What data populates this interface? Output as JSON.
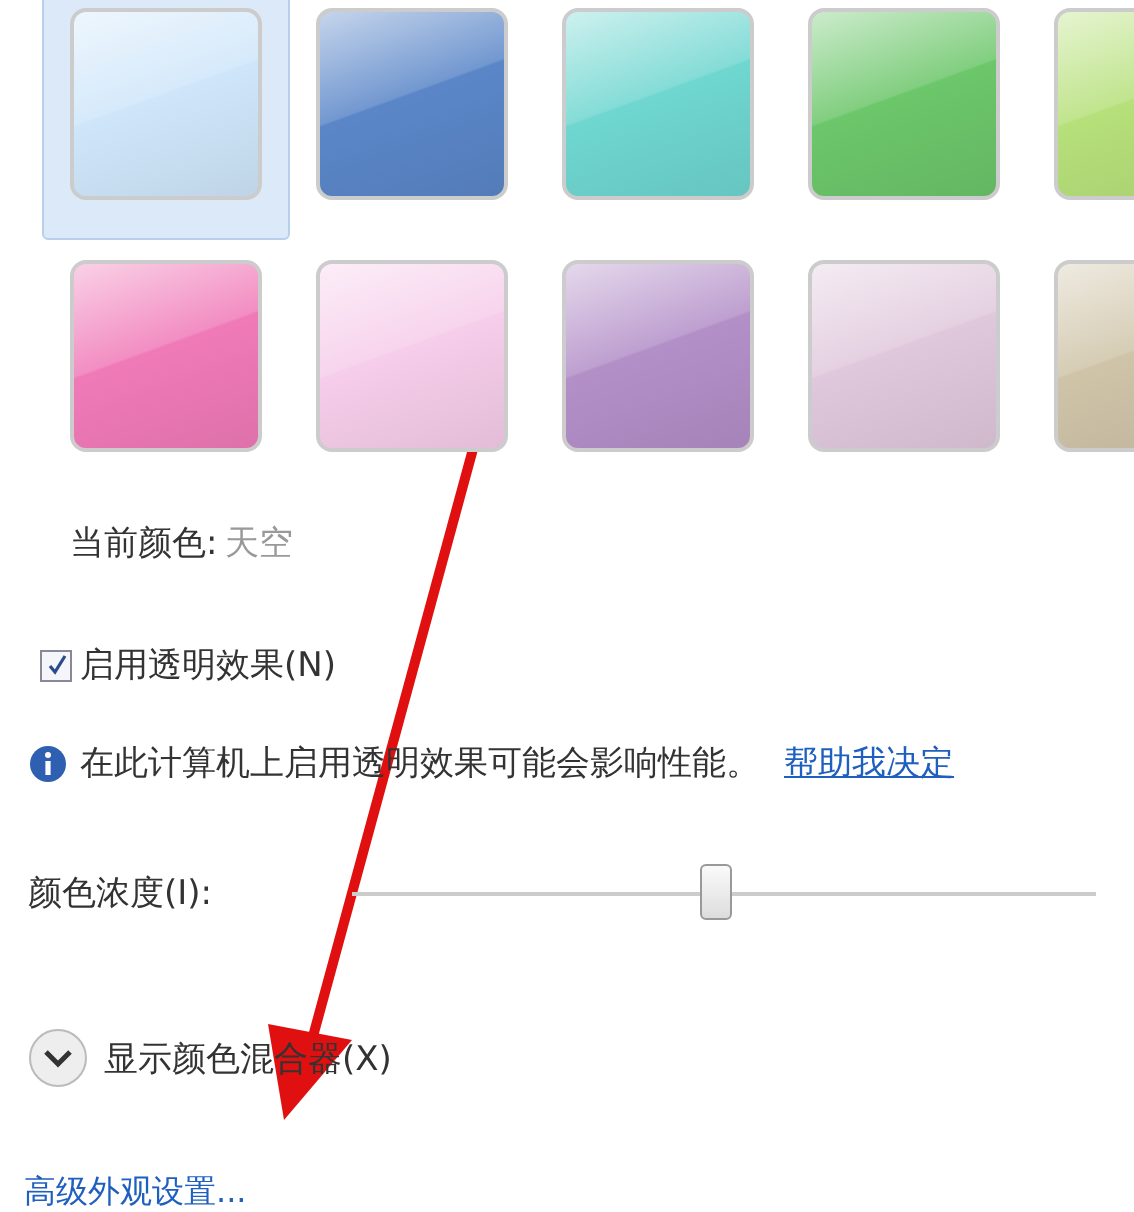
{
  "swatches": [
    {
      "color": "#cfe6fa",
      "selected": true
    },
    {
      "color": "#5a86c8",
      "selected": false
    },
    {
      "color": "#6fd6d0",
      "selected": false
    },
    {
      "color": "#6cc66a",
      "selected": false
    },
    {
      "color": "#b6e07a",
      "selected": false
    },
    {
      "color": "#f07ab8",
      "selected": false
    },
    {
      "color": "#f6cdea",
      "selected": false
    },
    {
      "color": "#b38fc8",
      "selected": false
    },
    {
      "color": "#e0c8dc",
      "selected": false
    },
    {
      "color": "#cfc4a8",
      "selected": false
    }
  ],
  "current_color": {
    "label": "当前颜色:",
    "value": "天空"
  },
  "transparency": {
    "label": "启用透明效果(N)",
    "checked": true
  },
  "info": {
    "text": "在此计算机上启用透明效果可能会影响性能。",
    "link": "帮助我决定"
  },
  "intensity": {
    "label": "颜色浓度(I):",
    "level": 0.49
  },
  "mixer": {
    "label": "显示颜色混合器(X)",
    "expanded": false
  },
  "advanced_link": "高级外观设置..."
}
